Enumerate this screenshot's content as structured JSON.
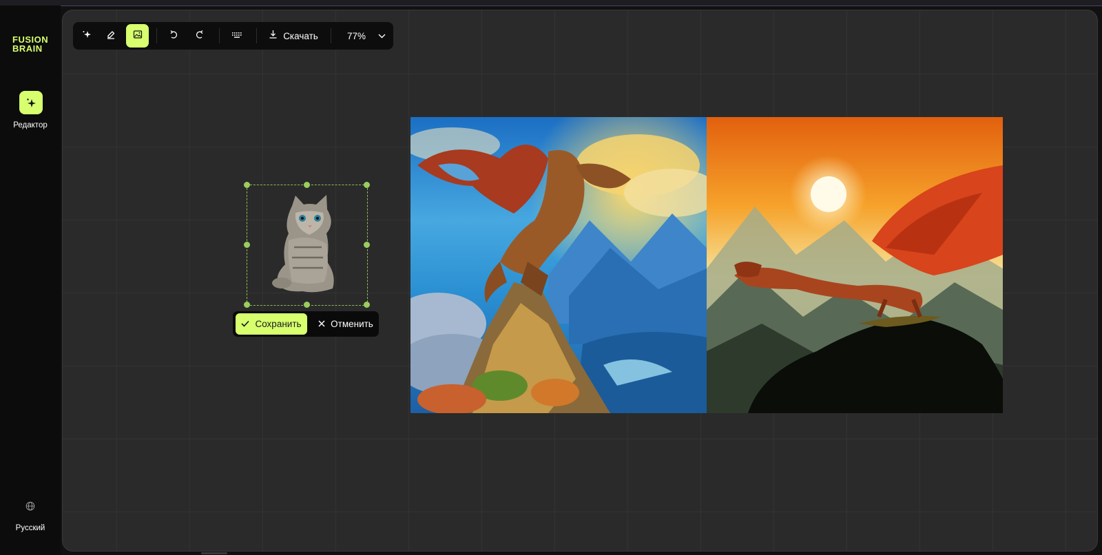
{
  "app": {
    "logo_line1": "FUSION",
    "logo_line2": "BRAIN",
    "accent_color": "#d7ff6e"
  },
  "sidebar": {
    "items": [
      {
        "label": "Редактор",
        "icon": "sparkle-icon",
        "active": true
      }
    ],
    "language_label": "Русский",
    "language_icon": "globe-icon"
  },
  "toolbar": {
    "tools": [
      {
        "name": "generate",
        "icon": "sparkle-icon",
        "active": false
      },
      {
        "name": "eraser",
        "icon": "eraser-icon",
        "active": false
      },
      {
        "name": "add-image",
        "icon": "image-add-icon",
        "active": true
      }
    ],
    "undo_icon": "undo-icon",
    "redo_icon": "redo-icon",
    "keyboard_icon": "keyboard-icon",
    "download_label": "Скачать",
    "zoom_label": "77%"
  },
  "canvas": {
    "images": [
      {
        "name": "dragon-on-mountain-peak",
        "description_icon": "image"
      },
      {
        "name": "dragon-sunset-cliff",
        "description_icon": "image"
      }
    ],
    "inserted_object": "kitten-sticker"
  },
  "confirm_bar": {
    "save_label": "Сохранить",
    "cancel_label": "Отменить"
  }
}
